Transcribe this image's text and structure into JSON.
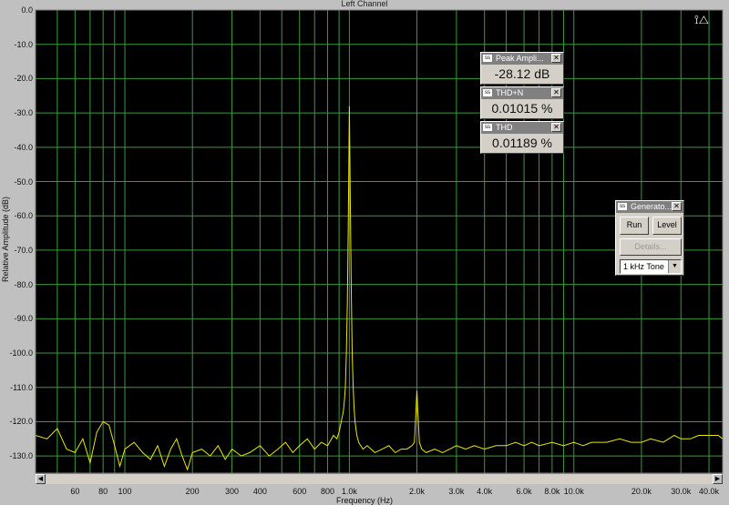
{
  "window": {
    "title": "Left Channel"
  },
  "colors": {
    "background": "#000000",
    "grid": "#3a9a3a",
    "trace": "#e8e800",
    "frame": "#c0c0c0"
  },
  "chart_data": {
    "type": "line",
    "title": "Left Channel",
    "xlabel": "Frequency (Hz)",
    "ylabel": "Relative Amplitude (dB)",
    "x_scale": "log",
    "xlim": [
      40,
      46000
    ],
    "ylim": [
      -135,
      0
    ],
    "grid": true,
    "y_ticks": [
      "0.0",
      "-10.0",
      "-20.0",
      "-30.0",
      "-40.0",
      "-50.0",
      "-60.0",
      "-70.0",
      "-80.0",
      "-90.0",
      "-100.0",
      "-110.0",
      "-120.0",
      "-130.0"
    ],
    "x_ticks": [
      {
        "label": "60",
        "value": 60
      },
      {
        "label": "80",
        "value": 80
      },
      {
        "label": "100",
        "value": 100
      },
      {
        "label": "200",
        "value": 200
      },
      {
        "label": "300",
        "value": 300
      },
      {
        "label": "400",
        "value": 400
      },
      {
        "label": "600",
        "value": 600
      },
      {
        "label": "800",
        "value": 800
      },
      {
        "label": "1.0k",
        "value": 1000
      },
      {
        "label": "2.0k",
        "value": 2000
      },
      {
        "label": "3.0k",
        "value": 3000
      },
      {
        "label": "4.0k",
        "value": 4000
      },
      {
        "label": "6.0k",
        "value": 6000
      },
      {
        "label": "8.0k",
        "value": 8000
      },
      {
        "label": "10.0k",
        "value": 10000
      },
      {
        "label": "20.0k",
        "value": 20000
      },
      {
        "label": "30.0k",
        "value": 30000
      },
      {
        "label": "40.0k",
        "value": 40000
      }
    ],
    "series": [
      {
        "x": [
          40,
          45,
          50,
          55,
          60,
          65,
          70,
          75,
          80,
          85,
          90,
          95,
          100,
          110,
          120,
          130,
          140,
          150,
          160,
          170,
          180,
          190,
          200,
          220,
          240,
          260,
          280,
          300,
          330,
          360,
          400,
          440,
          480,
          520,
          560,
          600,
          650,
          700,
          750,
          800,
          850,
          880,
          900,
          920,
          940,
          950,
          960,
          970,
          980,
          990,
          1000,
          1010,
          1020,
          1030,
          1040,
          1050,
          1060,
          1080,
          1100,
          1150,
          1200,
          1300,
          1400,
          1500,
          1600,
          1700,
          1800,
          1900,
          1950,
          2000,
          2050,
          2100,
          2200,
          2400,
          2600,
          2800,
          3000,
          3300,
          3600,
          4000,
          4500,
          5000,
          5500,
          6000,
          6500,
          7000,
          8000,
          9000,
          10000,
          11000,
          12000,
          14000,
          16000,
          18000,
          20000,
          22000,
          25000,
          28000,
          30000,
          33000,
          36000,
          40000,
          44000,
          46000
        ],
        "y": [
          -124,
          -125,
          -122,
          -128,
          -129,
          -125,
          -132,
          -123,
          -120,
          -121,
          -127,
          -133,
          -128,
          -126,
          -129,
          -131,
          -127,
          -133,
          -128,
          -125,
          -130,
          -134,
          -129,
          -128,
          -130,
          -127,
          -131,
          -128,
          -130,
          -129,
          -127,
          -130,
          -128,
          -126,
          -129,
          -127,
          -125,
          -128,
          -126,
          -127,
          -124,
          -125,
          -123,
          -120,
          -117,
          -114,
          -110,
          -100,
          -85,
          -60,
          -28.12,
          -55,
          -82,
          -100,
          -110,
          -116,
          -120,
          -124,
          -126,
          -128,
          -127,
          -129,
          -128,
          -127,
          -129,
          -128,
          -128,
          -127,
          -126,
          -111,
          -126,
          -128,
          -129,
          -128,
          -129,
          -128,
          -127,
          -128,
          -127,
          -128,
          -127,
          -127,
          -126,
          -127,
          -126,
          -127,
          -126,
          -127,
          -126,
          -127,
          -126,
          -126,
          -125,
          -126,
          -126,
          -125,
          -126,
          -124,
          -125,
          -125,
          -124,
          -124,
          -124,
          -125
        ]
      }
    ]
  },
  "toolbar": {
    "cursor_icon": "⟟△"
  },
  "scrollbar": {
    "left_arrow": "◀",
    "right_arrow": "▶"
  },
  "meters": [
    {
      "name": "peak-amplitude",
      "label": "Peak Ampli...",
      "value": "-28.12 dB"
    },
    {
      "name": "thd-n",
      "label": "THD+N",
      "value": "0.01015 %"
    },
    {
      "name": "thd",
      "label": "THD",
      "value": "0.01189 %"
    }
  ],
  "generator": {
    "label": "Generato...",
    "run": "Run",
    "level": "Level",
    "details": "Details...",
    "selected": "1 kHz Tone",
    "dropdown_arrow": "▼"
  },
  "close_glyph": "✕",
  "window_icon": "ss"
}
